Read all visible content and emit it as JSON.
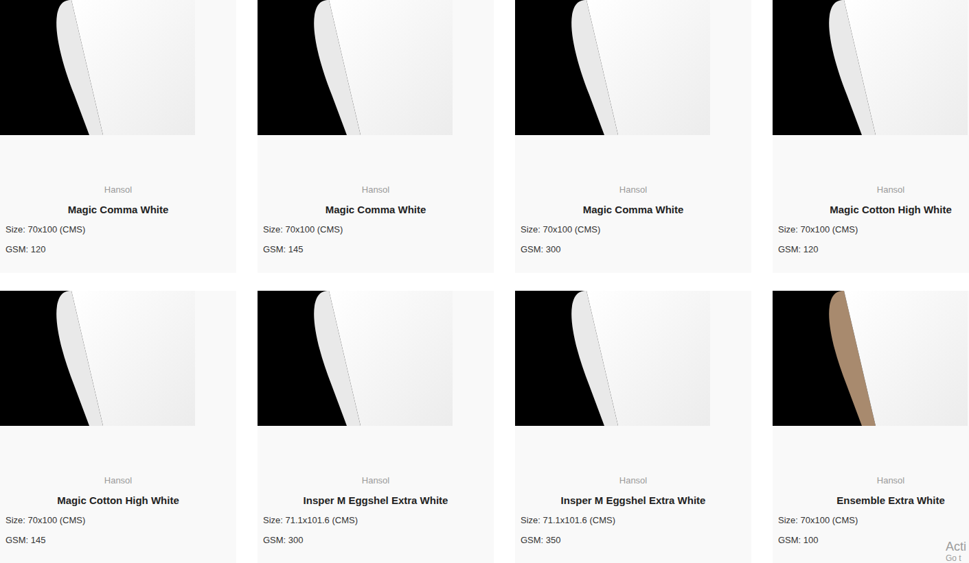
{
  "products": [
    {
      "brand": "Hansol",
      "name": "Magic Comma White",
      "size": "Size: 70x100 (CMS)",
      "gsm": "GSM: 120",
      "color": "#e9e9e9"
    },
    {
      "brand": "Hansol",
      "name": "Magic Comma White",
      "size": "Size: 70x100 (CMS)",
      "gsm": "GSM: 145",
      "color": "#e9e9e9"
    },
    {
      "brand": "Hansol",
      "name": "Magic Comma White",
      "size": "Size: 70x100 (CMS)",
      "gsm": "GSM: 300",
      "color": "#e9e9e9"
    },
    {
      "brand": "Hansol",
      "name": "Magic Cotton High White",
      "size": "Size: 70x100 (CMS)",
      "gsm": "GSM: 120",
      "color": "#e9e9e9"
    },
    {
      "brand": "Hansol",
      "name": "Magic Cotton High White",
      "size": "Size: 70x100 (CMS)",
      "gsm": "GSM: 145",
      "color": "#e9e9e9"
    },
    {
      "brand": "Hansol",
      "name": "Insper M Eggshel Extra White",
      "size": "Size: 71.1x101.6 (CMS)",
      "gsm": "GSM: 300",
      "color": "#e9e9e9"
    },
    {
      "brand": "Hansol",
      "name": "Insper M Eggshel Extra White",
      "size": "Size: 71.1x101.6 (CMS)",
      "gsm": "GSM: 350",
      "color": "#e9e9e9"
    },
    {
      "brand": "Hansol",
      "name": "Ensemble Extra White",
      "size": "Size: 70x100 (CMS)",
      "gsm": "GSM: 100",
      "color": "#a88a6e"
    }
  ],
  "watermark": {
    "line1": "Acti",
    "line2": "Go t"
  }
}
